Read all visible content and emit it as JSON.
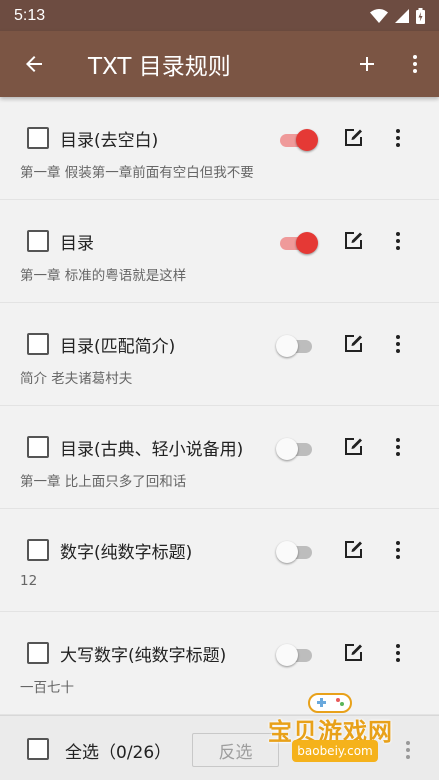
{
  "status_bar": {
    "time": "5:13"
  },
  "app_bar": {
    "title": "TXT 目录规则"
  },
  "rules": [
    {
      "name": "目录(去空白)",
      "example": "第一章 假装第一章前面有空白但我不要",
      "enabled": true
    },
    {
      "name": "目录",
      "example": "第一章 标准的粤语就是这样",
      "enabled": true
    },
    {
      "name": "目录(匹配简介)",
      "example": "简介 老夫诸葛村夫",
      "enabled": false
    },
    {
      "name": "目录(古典、轻小说备用)",
      "example": "第一章 比上面只多了回和话",
      "enabled": false
    },
    {
      "name": "数字(纯数字标题)",
      "example": "12",
      "enabled": false
    },
    {
      "name": "大写数字(纯数字标题)",
      "example": "一百七十",
      "enabled": false
    }
  ],
  "bottom_bar": {
    "select_all_label": "全选（0/26）",
    "invert_label": "反选"
  },
  "watermark": {
    "text": "宝贝游戏网",
    "url": "baobeiy.com"
  },
  "colors": {
    "primary": "#7b5544",
    "status_bar": "#6d4c41",
    "accent": "#e53935"
  }
}
